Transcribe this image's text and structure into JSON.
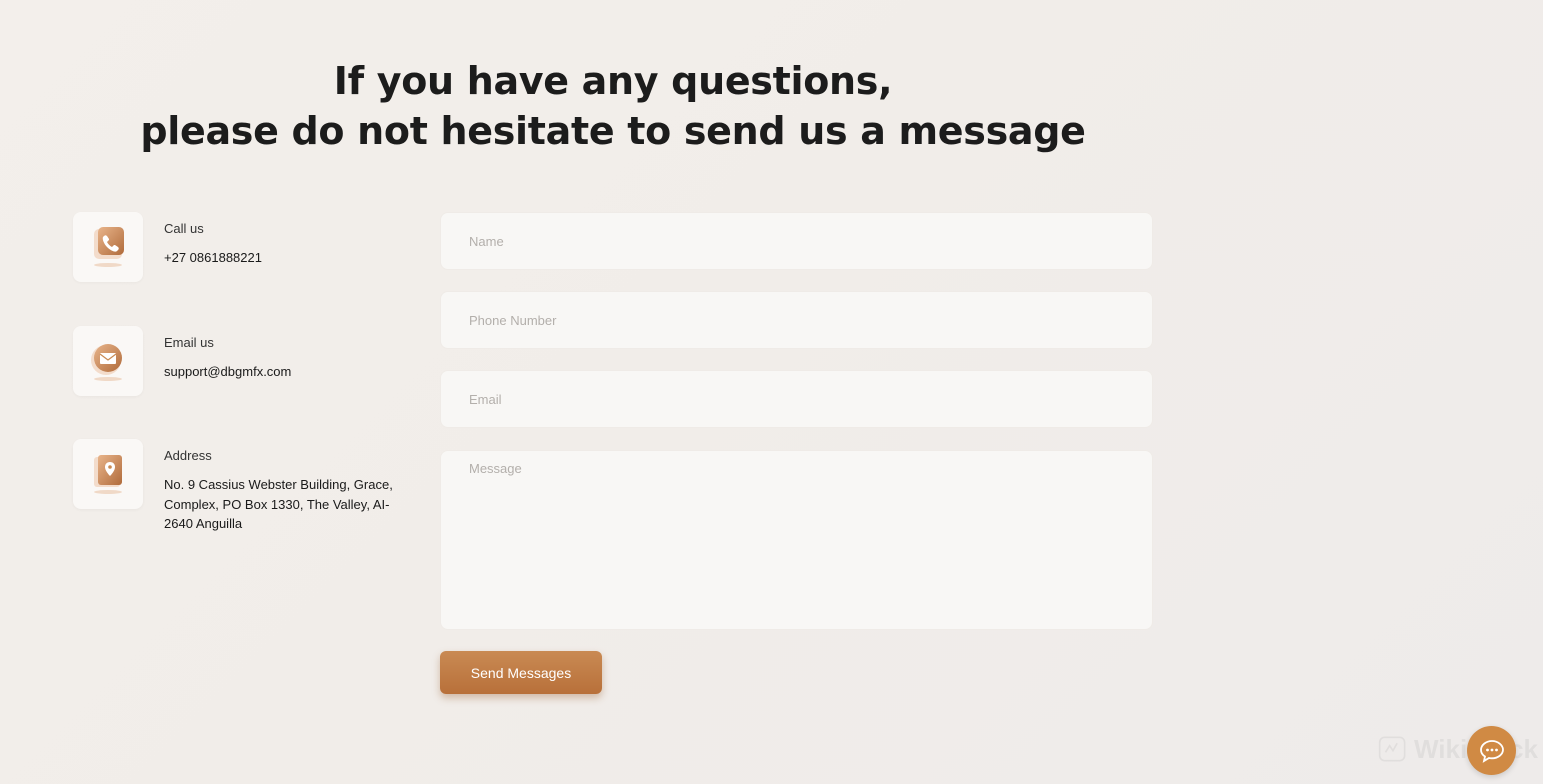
{
  "heading": {
    "line1": "If you have any questions,",
    "line2": "please do not hesitate to send us a message"
  },
  "contacts": [
    {
      "icon": "phone-icon",
      "label": "Call us",
      "value": "+27 0861888221"
    },
    {
      "icon": "mail-icon",
      "label": "Email us",
      "value": "support@dbgmfx.com"
    },
    {
      "icon": "location-icon",
      "label": "Address",
      "value": "No. 9 Cassius Webster Building, Grace, Complex, PO Box 1330, The Valley, AI-2640 Anguilla"
    }
  ],
  "form": {
    "name_placeholder": "Name",
    "phone_placeholder": "Phone Number",
    "email_placeholder": "Email",
    "message_placeholder": "Message",
    "submit_label": "Send Messages"
  },
  "watermark": {
    "text": "WikiStock"
  },
  "colors": {
    "accent": "#c07d46",
    "chat_button": "#d08a44",
    "background": "#f2eeea"
  }
}
